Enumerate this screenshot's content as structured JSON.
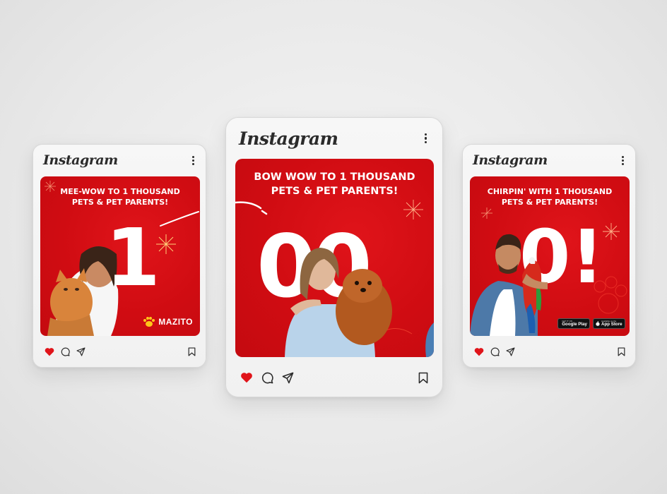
{
  "cards": [
    {
      "id": "left",
      "app_logo": "Instagram",
      "headline_line1": "MEE-WOW TO 1 THOUSAND",
      "headline_line2": "PETS & PET PARENTS!",
      "big_number": "1",
      "brand": "MAZITO",
      "photo_subject": "woman holding orange cat",
      "icons": [
        "heart-icon",
        "comment-icon",
        "share-icon",
        "bookmark-icon"
      ]
    },
    {
      "id": "center",
      "app_logo": "Instagram",
      "headline_line1": "BOW WOW  TO 1 THOUSAND",
      "headline_line2": "PETS & PET PARENTS!",
      "big_number": "00",
      "photo_subject": "woman holding pomeranian dog",
      "icons": [
        "heart-icon",
        "comment-icon",
        "share-icon",
        "bookmark-icon"
      ]
    },
    {
      "id": "right",
      "app_logo": "Instagram",
      "headline_line1": "CHIRPIN' WITH 1 THOUSAND",
      "headline_line2": "PETS & PET PARENTS!",
      "big_number": "0!",
      "photo_subject": "man holding parrot",
      "store_badges": [
        {
          "small": "GET IT ON",
          "big": "Google Play"
        },
        {
          "small": "Available on the",
          "big": "App Store"
        }
      ],
      "icons": [
        "heart-icon",
        "comment-icon",
        "share-icon",
        "bookmark-icon"
      ]
    }
  ],
  "colors": {
    "post_red": "#d40d12",
    "heart_red": "#e0141a",
    "card_bg": "#f4f4f4",
    "icon_dark": "#2b2b2b"
  }
}
